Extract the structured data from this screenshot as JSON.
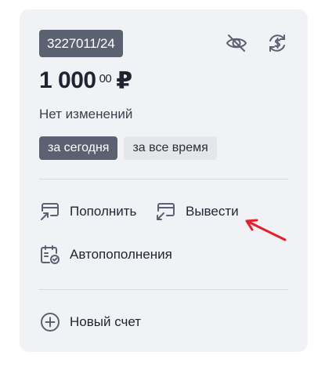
{
  "account": {
    "number": "3227011/24"
  },
  "balance": {
    "integer": "1 000",
    "cents": "00",
    "currency": "₽"
  },
  "change_text": "Нет изменений",
  "periods": [
    {
      "label": "за сегодня",
      "active": true
    },
    {
      "label": "за все время",
      "active": false
    }
  ],
  "actions": {
    "topup": "Пополнить",
    "withdraw": "Вывести",
    "autotopup": "Автопополнения",
    "new_account": "Новый счет"
  },
  "icons": {
    "hide": "eye-off-icon",
    "exchange": "currency-exchange-icon",
    "topup": "card-in-icon",
    "withdraw": "card-out-icon",
    "autotopup": "calendar-clock-icon",
    "new_account": "plus-circle-icon"
  },
  "colors": {
    "accent_dark": "#5b6170",
    "card_bg": "#f1f2f5",
    "arrow": "#e3212b"
  }
}
